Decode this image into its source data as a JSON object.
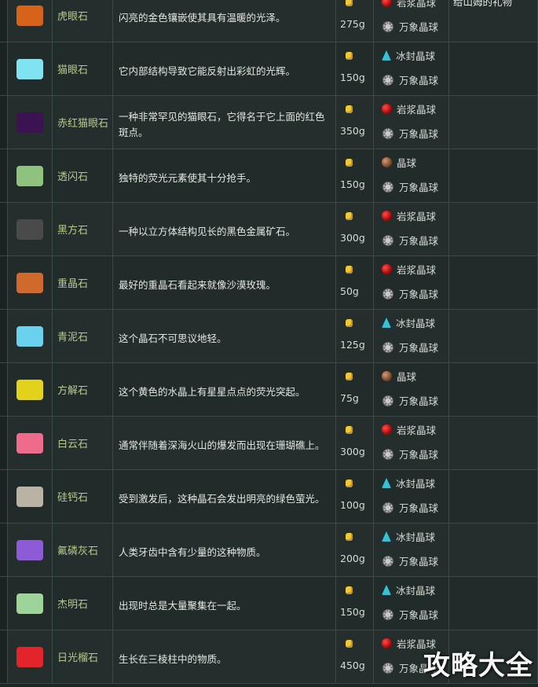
{
  "rows": [
    {
      "name": "虎眼石",
      "desc": "闪亮的金色镶嵌使其具有温暖的光泽。",
      "price": "275g",
      "orb1": {
        "label": "岩浆晶球",
        "type": "magma"
      },
      "orb2": {
        "label": "万象晶球",
        "type": "omni"
      },
      "gift": "给山姆的礼物",
      "gem_color": "#d7621a",
      "gem_icon": "tiger-eye-icon"
    },
    {
      "name": "猫眼石",
      "desc": "它内部结构导致它能反射出彩虹的光辉。",
      "price": "150g",
      "orb1": {
        "label": "冰封晶球",
        "type": "frost"
      },
      "orb2": {
        "label": "万象晶球",
        "type": "omni"
      },
      "gift": "",
      "gem_color": "#7fe3f2",
      "gem_icon": "opal-icon"
    },
    {
      "name": "赤红猫眼石",
      "desc": "一种非常罕见的猫眼石，它得名于它上面的红色斑点。",
      "price": "350g",
      "orb1": {
        "label": "岩浆晶球",
        "type": "magma"
      },
      "orb2": {
        "label": "万象晶球",
        "type": "omni"
      },
      "gift": "",
      "gem_color": "#3b1353",
      "gem_icon": "fire-opal-icon"
    },
    {
      "name": "透闪石",
      "desc": "独特的荧光元素使其十分抢手。",
      "price": "150g",
      "orb1": {
        "label": "晶球",
        "type": "plain"
      },
      "orb2": {
        "label": "万象晶球",
        "type": "omni"
      },
      "gift": "",
      "gem_color": "#8ec27e",
      "gem_icon": "tremolite-icon"
    },
    {
      "name": "黑方石",
      "desc": "一种以立方体结构见长的黑色金属矿石。",
      "price": "300g",
      "orb1": {
        "label": "岩浆晶球",
        "type": "magma"
      },
      "orb2": {
        "label": "万象晶球",
        "type": "omni"
      },
      "gift": "",
      "gem_color": "#4a4a4a",
      "gem_icon": "nekoite-icon"
    },
    {
      "name": "重晶石",
      "desc": "最好的重晶石看起来就像沙漠玫瑰。",
      "price": "50g",
      "orb1": {
        "label": "岩浆晶球",
        "type": "magma"
      },
      "orb2": {
        "label": "万象晶球",
        "type": "omni"
      },
      "gift": "",
      "gem_color": "#d06a2c",
      "gem_icon": "baryte-icon"
    },
    {
      "name": "青泥石",
      "desc": "这个晶石不可思议地轻。",
      "price": "125g",
      "orb1": {
        "label": "冰封晶球",
        "type": "frost"
      },
      "orb2": {
        "label": "万象晶球",
        "type": "omni"
      },
      "gift": "",
      "gem_color": "#6ad2ee",
      "gem_icon": "celestine-icon"
    },
    {
      "name": "方解石",
      "desc": "这个黄色的水晶上有星星点点的荧光突起。",
      "price": "75g",
      "orb1": {
        "label": "晶球",
        "type": "plain"
      },
      "orb2": {
        "label": "万象晶球",
        "type": "omni"
      },
      "gift": "",
      "gem_color": "#e3d21c",
      "gem_icon": "calcite-icon"
    },
    {
      "name": "白云石",
      "desc": "通常伴随着深海火山的爆发而出现在珊瑚礁上。",
      "price": "300g",
      "orb1": {
        "label": "岩浆晶球",
        "type": "magma"
      },
      "orb2": {
        "label": "万象晶球",
        "type": "omni"
      },
      "gift": "",
      "gem_color": "#ef6b8c",
      "gem_icon": "dolomite-icon"
    },
    {
      "name": "硅钙石",
      "desc": "受到激发后，这种晶石会发出明亮的绿色萤光。",
      "price": "100g",
      "orb1": {
        "label": "冰封晶球",
        "type": "frost"
      },
      "orb2": {
        "label": "万象晶球",
        "type": "omni"
      },
      "gift": "",
      "gem_color": "#b9b3a6",
      "gem_icon": "hardystonite-icon"
    },
    {
      "name": "氟磷灰石",
      "desc": "人类牙齿中含有少量的这种物质。",
      "price": "200g",
      "orb1": {
        "label": "冰封晶球",
        "type": "frost"
      },
      "orb2": {
        "label": "万象晶球",
        "type": "omni"
      },
      "gift": "",
      "gem_color": "#8d5bd8",
      "gem_icon": "fluorapatite-icon"
    },
    {
      "name": "杰明石",
      "desc": "出现时总是大量聚集在一起。",
      "price": "150g",
      "orb1": {
        "label": "冰封晶球",
        "type": "frost"
      },
      "orb2": {
        "label": "万象晶球",
        "type": "omni"
      },
      "gift": "",
      "gem_color": "#9ed39a",
      "gem_icon": "geminite-icon"
    },
    {
      "name": "日光榴石",
      "desc": "生长在三棱柱中的物质。",
      "price": "450g",
      "orb1": {
        "label": "岩浆晶球",
        "type": "magma"
      },
      "orb2": {
        "label": "万象晶球",
        "type": "omni"
      },
      "gift": "",
      "gem_color": "#e3242b",
      "gem_icon": "helvite-icon"
    }
  ],
  "watermark": "攻略大全"
}
